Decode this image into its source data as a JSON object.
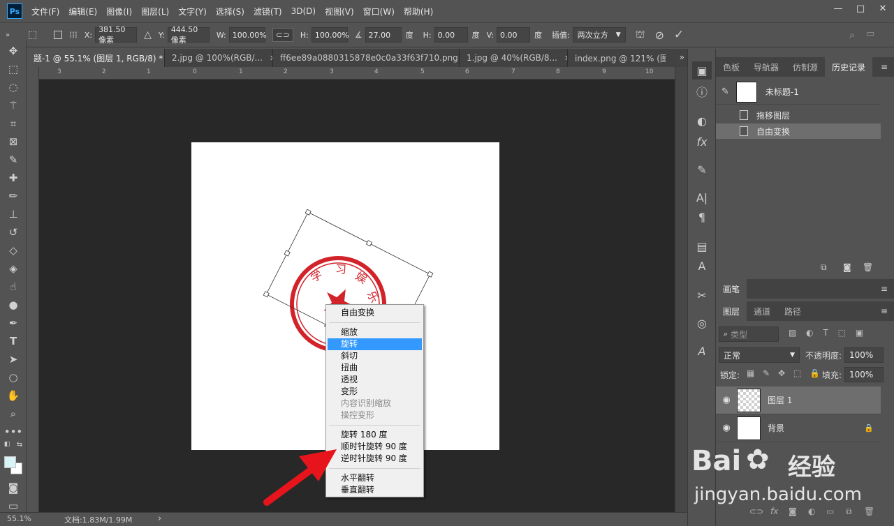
{
  "menubar": {
    "logo": "Ps",
    "items": [
      "文件(F)",
      "编辑(E)",
      "图像(I)",
      "图层(L)",
      "文字(Y)",
      "选择(S)",
      "滤镜(T)",
      "3D(D)",
      "视图(V)",
      "窗口(W)",
      "帮助(H)"
    ],
    "window_controls": [
      "—",
      "□",
      "✕"
    ]
  },
  "options": {
    "x_label": "X:",
    "x_value": "381.50 像素",
    "y_label": "Y:",
    "y_value": "444.50 像素",
    "w_label": "W:",
    "w_value": "100.00%",
    "h_label": "H:",
    "h_value": "100.00%",
    "angle_value": "27.00",
    "angle_unit": "度",
    "skew_h_label": "H:",
    "skew_h_value": "0.00",
    "skew_h_unit": "度",
    "skew_v_label": "V:",
    "skew_v_value": "0.00",
    "skew_v_unit": "度",
    "interp_label": "插值:",
    "interp_value": "两次立方"
  },
  "tabs": [
    {
      "label": "题-1 @ 55.1% (图层 1, RGB/8) *",
      "close": "✕"
    },
    {
      "label": "2.jpg @ 100%(RGB/...",
      "close": "✕"
    },
    {
      "label": "ff6ee89a0880315878e0c0a33f63f710.png",
      "close": "✕"
    },
    {
      "label": "1.jpg @ 40%(RGB/8...",
      "close": "✕"
    },
    {
      "label": "index.png @ 121% (图",
      "close": ""
    }
  ],
  "tabs_more": "»",
  "ruler_h": [
    "3",
    "2",
    "1",
    "0",
    "1",
    "2",
    "3",
    "4",
    "5",
    "6",
    "7",
    "8",
    "9",
    "10"
  ],
  "seal_text": [
    "学",
    "习",
    "娱",
    "乐"
  ],
  "context_menu": {
    "items": [
      {
        "label": "自由变换",
        "state": "normal"
      },
      {
        "label": "缩放",
        "state": "normal"
      },
      {
        "label": "旋转",
        "state": "highlight"
      },
      {
        "label": "斜切",
        "state": "normal"
      },
      {
        "label": "扭曲",
        "state": "normal"
      },
      {
        "label": "透视",
        "state": "normal"
      },
      {
        "label": "变形",
        "state": "normal"
      },
      {
        "label": "内容识别缩放",
        "state": "disabled"
      },
      {
        "label": "操控变形",
        "state": "disabled"
      },
      {
        "label": "旋转 180 度",
        "state": "normal"
      },
      {
        "label": "顺时针旋转 90 度",
        "state": "normal"
      },
      {
        "label": "逆时针旋转 90 度",
        "state": "normal"
      },
      {
        "label": "水平翻转",
        "state": "normal"
      },
      {
        "label": "垂直翻转",
        "state": "normal"
      }
    ]
  },
  "status": {
    "zoom": "55.1%",
    "doc_info": "文档:1.83M/1.99M",
    "arrow": "›"
  },
  "history_panel": {
    "tabs": [
      "色板",
      "导航器",
      "仿制源",
      "历史记录"
    ],
    "active_tab": "历史记录",
    "snapshot_name": "未标题-1",
    "items": [
      {
        "label": "拖移图层",
        "selected": false
      },
      {
        "label": "自由变换",
        "selected": true
      }
    ]
  },
  "brush_panel": {
    "tab": "画笔"
  },
  "layers_panel": {
    "tabs": [
      "图层",
      "通道",
      "路径"
    ],
    "active_tab": "图层",
    "filter_placeholder": "类型",
    "blend_mode": "正常",
    "opacity_label": "不透明度:",
    "opacity_value": "100%",
    "lock_label": "锁定:",
    "fill_label": "填充:",
    "fill_value": "100%",
    "layers": [
      {
        "name": "图层 1",
        "selected": true
      },
      {
        "name": "背景",
        "selected": false
      }
    ]
  },
  "watermark": {
    "brand": "Bai",
    "brand_cn": "经验",
    "url": "jingyan.baidu.com"
  },
  "colors": {
    "seal_red": "#d2232a",
    "arrow_red": "#e8141c",
    "menu_highlight": "#3399ff",
    "foreground": "#d8f4f6",
    "background": "#ffffff"
  }
}
